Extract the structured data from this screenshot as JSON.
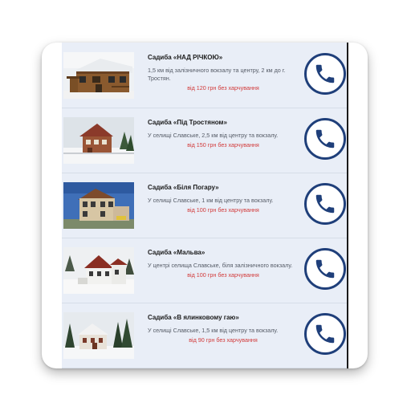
{
  "listings": [
    {
      "title": "Садиба «НАД РІЧКОЮ»",
      "description": "1,5 км від залізничного вокзалу та центру, 2 км до г. Тростян.",
      "price": "від 120 грн без харчування",
      "phone_icon": "phone-icon",
      "image": "wooden-house-photo"
    },
    {
      "title": "Садиба «Під Тростяном»",
      "description": "У селищі Славське, 2,5 км від центру та вокзалу.",
      "price": "від 150 грн без харчування",
      "phone_icon": "phone-icon",
      "image": "brick-house-snow-photo"
    },
    {
      "title": "Садиба «Біля Погару»",
      "description": "У селищі Славське, 1 км від центру та вокзалу.",
      "price": "від 100 грн без харчування",
      "phone_icon": "phone-icon",
      "image": "house-blue-sky-photo"
    },
    {
      "title": "Садиба «Мальва»",
      "description": "У центрі селища Славське, біля залізничного вокзалу.",
      "price": "від 100 грн без харчування",
      "phone_icon": "phone-icon",
      "image": "white-house-winter-photo"
    },
    {
      "title": "Садиба «В ялинковому гаю»",
      "description": "У селищі Славське, 1,5 км від центру та вокзалу.",
      "price": "від 90 грн без харчування",
      "phone_icon": "phone-icon",
      "image": "house-fir-grove-photo"
    }
  ],
  "colors": {
    "panel_bg": "#e9eef7",
    "price_text": "#d23a3a",
    "call_button_accent": "#1f3f7a"
  }
}
